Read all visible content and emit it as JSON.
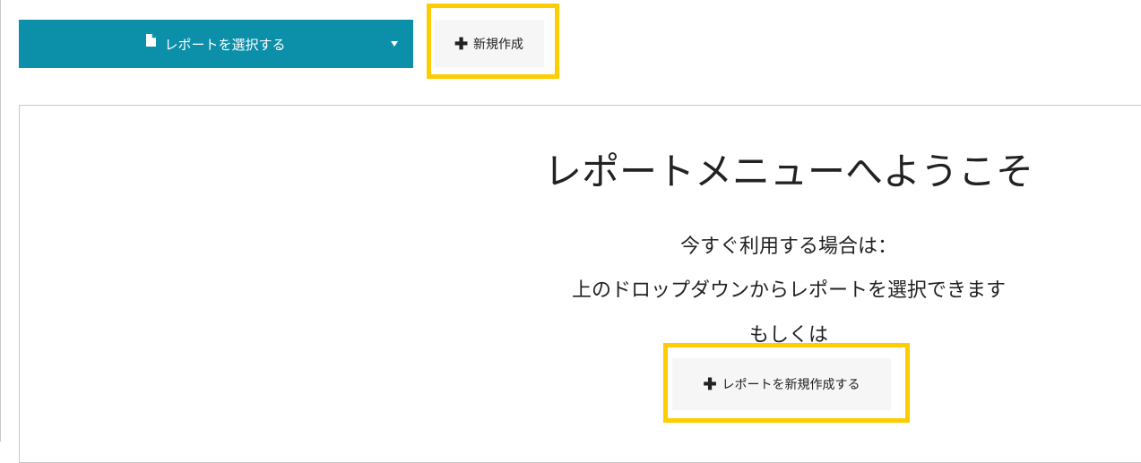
{
  "toolbar": {
    "report_select_label": "レポートを選択する",
    "new_button_label": "新規作成"
  },
  "welcome": {
    "title": "レポートメニューへようこそ",
    "line1": "今すぐ利用する場合は：",
    "line2": "上のドロップダウンからレポートを選択できます",
    "line3": "もしくは",
    "create_button_label": "レポートを新規作成する"
  },
  "icons": {
    "report_select": "file-icon",
    "dropdown": "caret-down-icon",
    "new_button": "plus-icon",
    "create_button": "plus-icon"
  },
  "colors": {
    "primary": "#0c8fa9",
    "highlight": "#ffcc00",
    "button_bg": "#f6f6f6"
  }
}
